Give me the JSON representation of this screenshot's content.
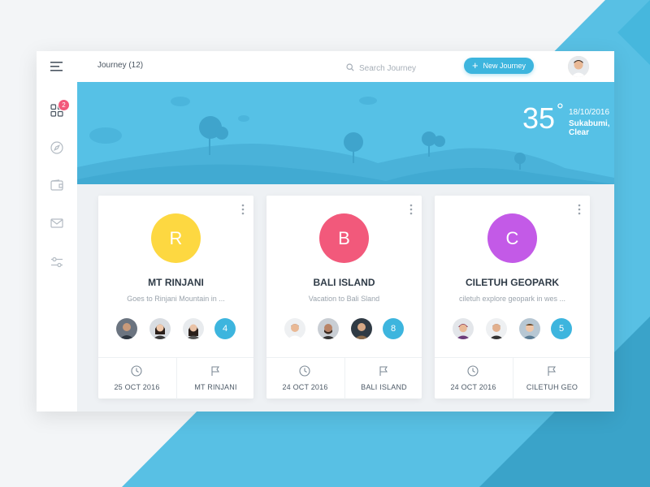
{
  "colors": {
    "accent": "#3db5de",
    "badge": "#f2597b",
    "hero_sky": "#56c1e6",
    "diag_1": "#5fc4e6",
    "diag_2": "#3aa6cc"
  },
  "topbar": {
    "breadcrumb": "Journey (12)",
    "search_placeholder": "Search Journey",
    "new_button_label": "New Journey",
    "avatar": "user-avatar"
  },
  "sidebar": {
    "badge_count": "2",
    "items": [
      {
        "icon": "menu-icon"
      },
      {
        "icon": "grid-icon"
      },
      {
        "icon": "compass-icon"
      },
      {
        "icon": "wallet-icon"
      },
      {
        "icon": "mail-icon"
      },
      {
        "icon": "sliders-icon"
      }
    ]
  },
  "weather": {
    "temperature": "35",
    "degree_symbol": "°",
    "date": "18/10/2016",
    "location": "Sukabumi, Clear"
  },
  "cards": [
    {
      "letter": "R",
      "color": "#fdd841",
      "title": "MT RINJANI",
      "description": "Goes to Rinjani Mountain in ...",
      "member_count": "4",
      "date": "25 OCT 2016",
      "destination": "MT RINJANI"
    },
    {
      "letter": "B",
      "color": "#f2597b",
      "title": "BALI ISLAND",
      "description": "Vacation to Bali Sland",
      "member_count": "8",
      "date": "24 OCT 2016",
      "destination": "BALI ISLAND"
    },
    {
      "letter": "C",
      "color": "#c35ae7",
      "title": "CILETUH GEOPARK",
      "description": "ciletuh explore geopark in wes ...",
      "member_count": "5",
      "date": "24 OCT 2016",
      "destination": "CILETUH GEO"
    }
  ]
}
